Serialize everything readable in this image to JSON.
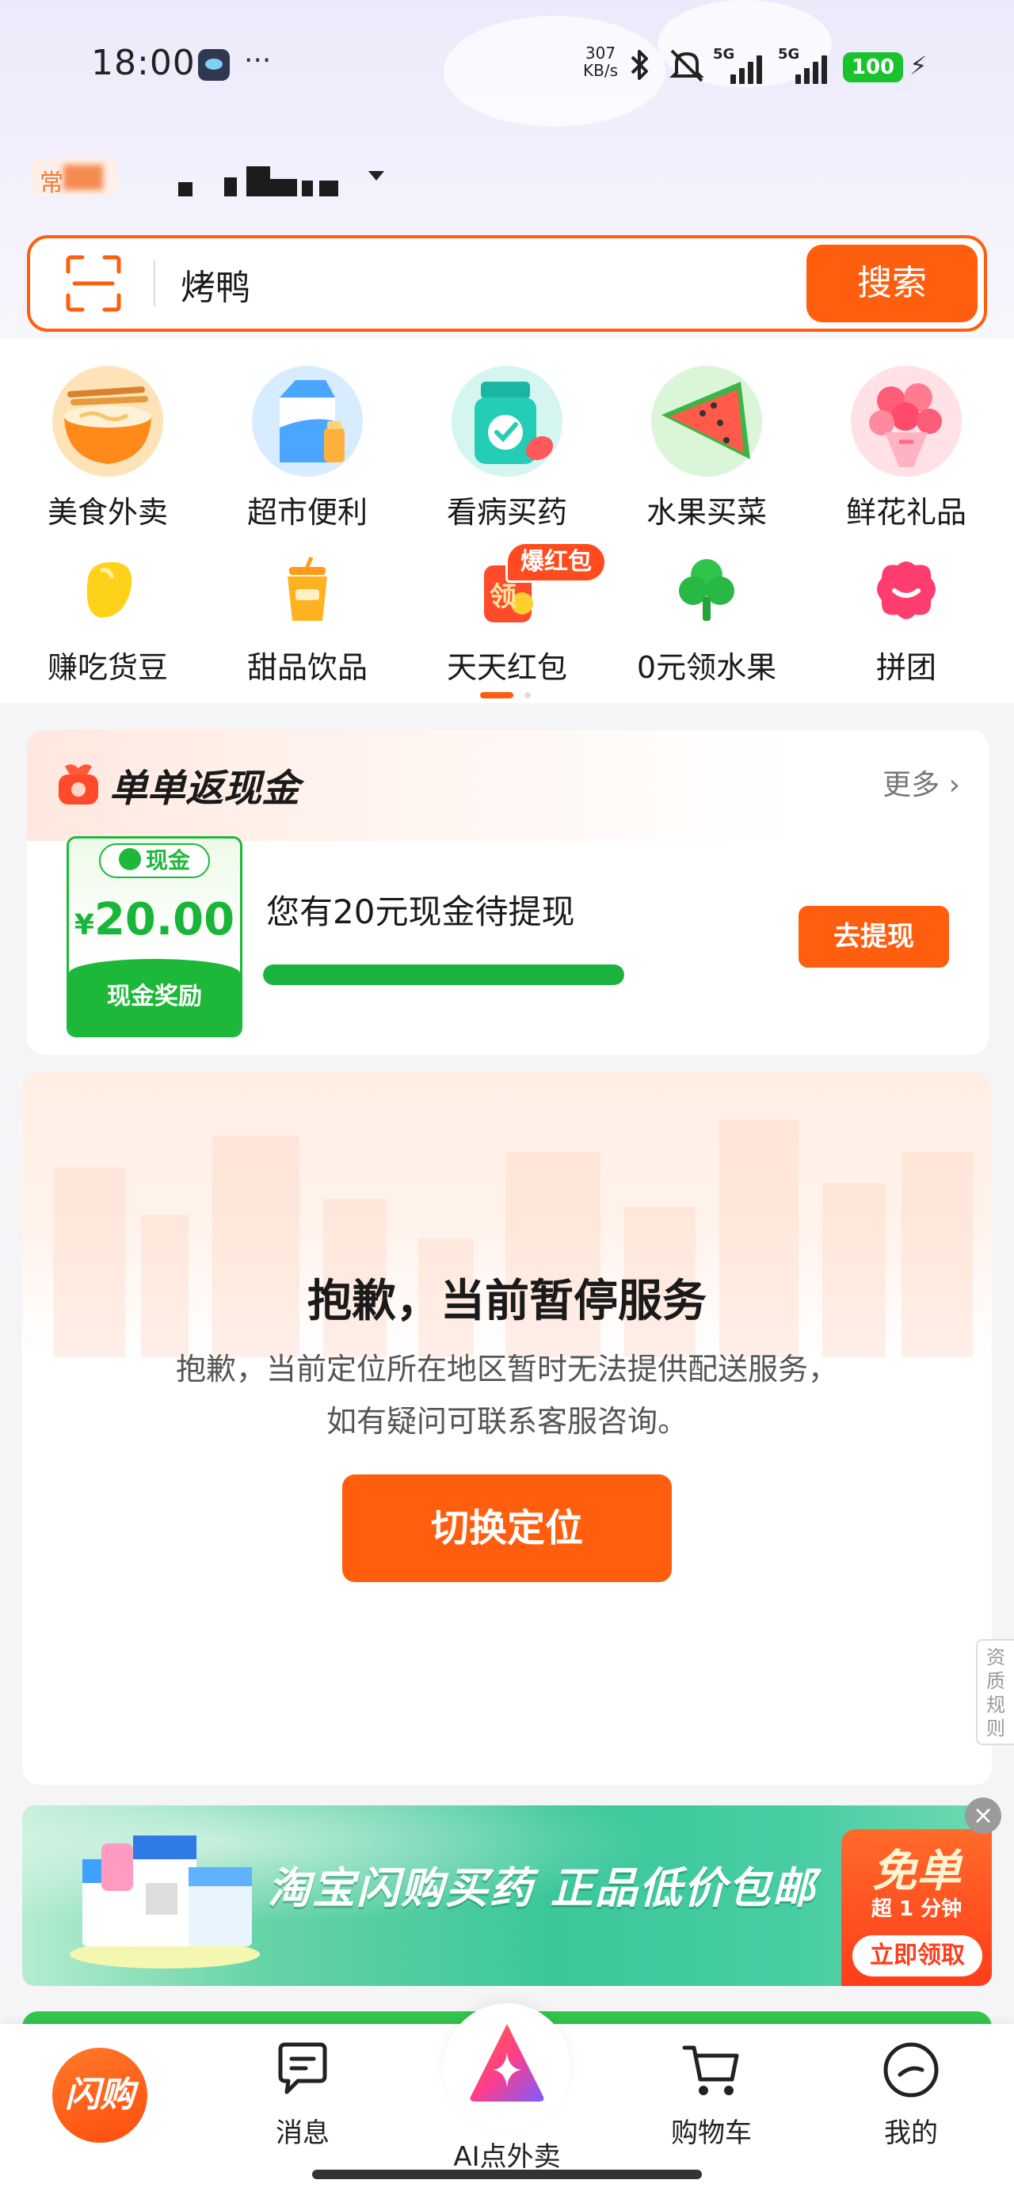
{
  "status_bar": {
    "time": "18:00",
    "more": "···",
    "net_speed_value": "307",
    "net_speed_unit": "KB/s",
    "signal_1": "5G",
    "signal_2": "5G",
    "battery": "100"
  },
  "location": {
    "tag_prefix": "常"
  },
  "search": {
    "query": "烤鸭",
    "button_label": "搜索"
  },
  "categories_main": [
    {
      "label": "美食外卖",
      "icon": "noodle-bowl-icon"
    },
    {
      "label": "超市便利",
      "icon": "milk-carton-icon"
    },
    {
      "label": "看病买药",
      "icon": "medicine-bottle-icon"
    },
    {
      "label": "水果买菜",
      "icon": "watermelon-icon"
    },
    {
      "label": "鲜花礼品",
      "icon": "flower-bouquet-icon"
    }
  ],
  "categories_sub": [
    {
      "label": "赚吃货豆",
      "icon": "bean-icon"
    },
    {
      "label": "甜品饮品",
      "icon": "drink-cup-icon"
    },
    {
      "label": "天天红包",
      "icon": "red-packet-icon",
      "badge": "爆红包",
      "glyph": "领"
    },
    {
      "label": "0元领水果",
      "icon": "fruit-tree-icon"
    },
    {
      "label": "拼团",
      "icon": "group-buy-icon"
    }
  ],
  "cashback": {
    "title": "单单返现金",
    "more_label": "更多",
    "voucher_tag": "现金",
    "voucher_currency": "¥",
    "voucher_amount": "20.00",
    "voucher_caption": "现金奖励",
    "description": "您有20元现金待提现",
    "progress_fraction": 1.0,
    "withdraw_label": "去提现"
  },
  "notice": {
    "title": "抱歉，当前暂停服务",
    "line1": "抱歉，当前定位所在地区暂时无法提供配送服务，",
    "line2": "如有疑问可联系客服咨询。",
    "button_label": "切换定位",
    "side_tab": "资质规则"
  },
  "ad_banner": {
    "headline": "淘宝闪购买药 正品低价包邮",
    "badge_title": "免单",
    "badge_sub": "超 1 分钟",
    "badge_button": "立即领取",
    "close": "×"
  },
  "bottom_nav": {
    "home_label": "闪购",
    "messages_label": "消息",
    "ai_label": "AI点外卖",
    "cart_label": "购物车",
    "profile_label": "我的"
  },
  "colors": {
    "accent": "#ff5e0e",
    "green": "#1db83a"
  }
}
